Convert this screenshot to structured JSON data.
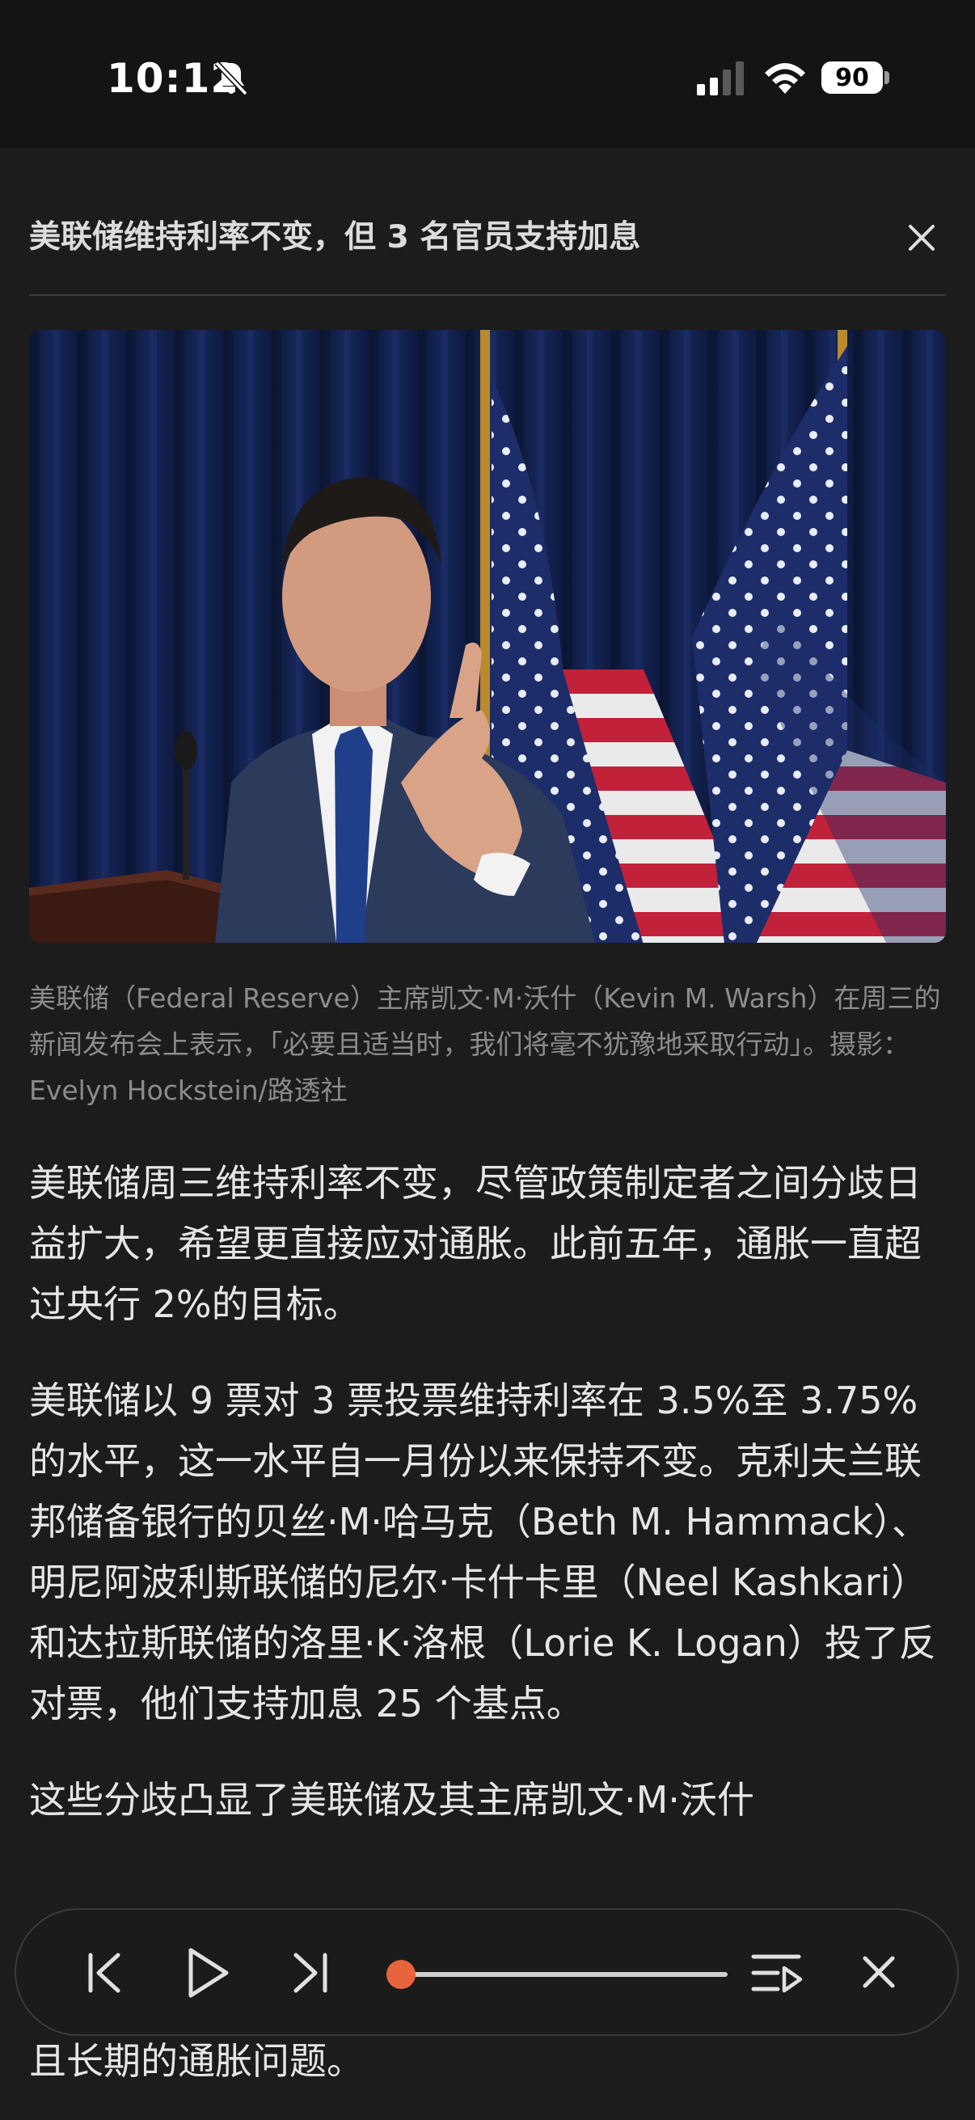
{
  "status_bar": {
    "time": "10:12",
    "battery": "90",
    "icons": [
      "bell-slash-icon",
      "signal-icon",
      "wifi-icon",
      "battery-icon"
    ]
  },
  "article": {
    "headline": "美联储维持利率不变，但 3 名官员支持加息",
    "caption": "美联储（Federal Reserve）主席凯文·M·沃什（Kevin M. Warsh）在周三的新闻发布会上表示，「必要且适当时，我们将毫不犹豫地采取行动」。摄影：Evelyn Hockstein/路透社",
    "paragraphs": [
      "美联储周三维持利率不变，尽管政策制定者之间分歧日益扩大，希望更直接应对通胀。此前五年，通胀一直超过央行 2%的目标。",
      "美联储以 9 票对 3 票投票维持利率在 3.5%至 3.75%的水平，这一水平自一月份以来保持不变。克利夫兰联邦储备银行的贝丝·M·哈马克（Beth M. Hammack）、明尼阿波利斯联储的尼尔·卡什卡里（Neel Kashkari）和达拉斯联储的洛里·K·洛根（Lorie K. Logan）投了反对票，他们支持加息 25 个基点。",
      "这些分歧凸显了美联储及其主席凯文·M·沃什"
    ],
    "partial_line": "且长期的通胀问题。"
  },
  "player": {
    "progress": 0.0,
    "icons": [
      "skip-back-icon",
      "play-icon",
      "skip-forward-icon",
      "playlist-icon",
      "close-icon"
    ]
  },
  "colors": {
    "background": "#1c1c1c",
    "accent": "#e8643c",
    "caption": "#8c8c8c"
  }
}
